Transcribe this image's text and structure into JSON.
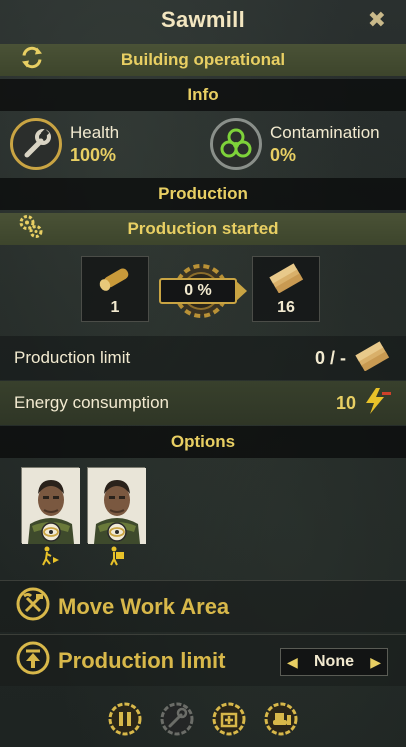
{
  "window": {
    "title": "Sawmill"
  },
  "status": {
    "text": "Building operational"
  },
  "info": {
    "header": "Info",
    "health": {
      "label": "Health",
      "value": "100%"
    },
    "contamination": {
      "label": "Contamination",
      "value": "0%"
    }
  },
  "production": {
    "header": "Production",
    "status": "Production started",
    "input_count": "1",
    "progress": "0 %",
    "progress_fraction": 0,
    "output_count": "16"
  },
  "limits": {
    "production_limit_label": "Production limit",
    "production_limit_value": "0 / -",
    "energy_label": "Energy consumption",
    "energy_value": "10"
  },
  "options": {
    "header": "Options"
  },
  "actions": {
    "move_work_area": "Move Work Area",
    "production_limit": "Production limit",
    "production_limit_selected": "None"
  },
  "colors": {
    "accent_gold": "#e8cf63",
    "olive_bar": "#4a5236",
    "dark_bar": "#0a0c0c",
    "energy": "#e8c229"
  },
  "icons": [
    "refresh-icon",
    "wrench-icon",
    "biohazard-icon",
    "gears-icon",
    "log-icon",
    "planks-icon",
    "lightning-icon",
    "eye-icon",
    "walk-arrow-icon",
    "carry-icon",
    "pickaxe-hammer-icon",
    "upload-icon",
    "pause-icon",
    "wrench-disabled-icon",
    "upgrade-icon",
    "bulldozer-icon"
  ]
}
